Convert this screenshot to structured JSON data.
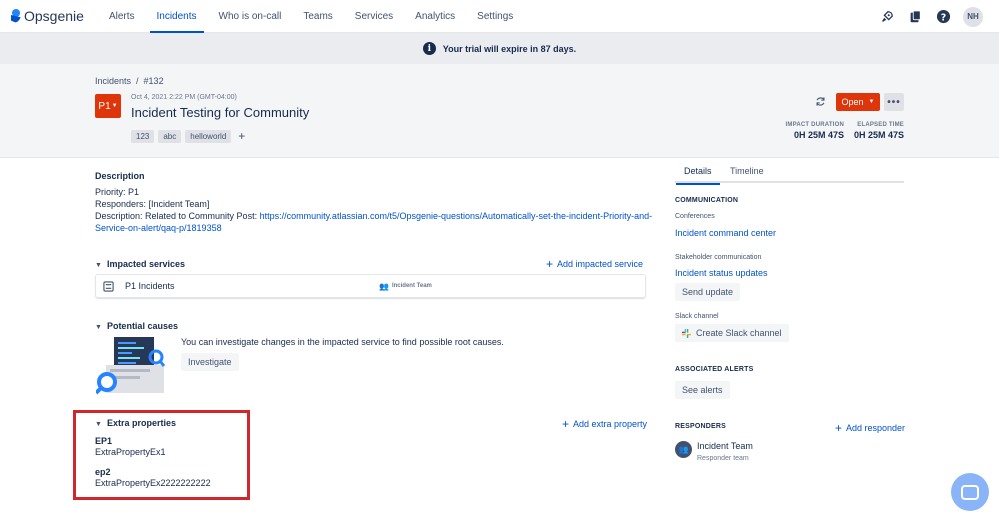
{
  "app": {
    "name": "Opsgenie"
  },
  "nav": {
    "items": [
      {
        "label": "Alerts",
        "active": false
      },
      {
        "label": "Incidents",
        "active": true
      },
      {
        "label": "Who is on-call",
        "active": false
      },
      {
        "label": "Teams",
        "active": false
      },
      {
        "label": "Services",
        "active": false
      },
      {
        "label": "Analytics",
        "active": false
      },
      {
        "label": "Settings",
        "active": false
      }
    ],
    "avatar_initials": "NH"
  },
  "banner": {
    "text": "Your trial will expire in 87 days."
  },
  "header": {
    "breadcrumb_root": "Incidents",
    "breadcrumb_sep": "/",
    "breadcrumb_id": "#132",
    "priority": "P1",
    "priority_color": "#de350b",
    "date": "Oct 4, 2021 2:22 PM (GMT-04:00)",
    "title": "Incident Testing for Community",
    "tags": [
      "123",
      "abc",
      "helloworld"
    ],
    "status_label": "Open",
    "status_color": "#de350b",
    "impact_duration_label": "IMPACT DURATION",
    "impact_duration": "0H 25M 47S",
    "elapsed_time_label": "ELAPSED TIME",
    "elapsed_time": "0H 25M 47S"
  },
  "description": {
    "heading": "Description",
    "priority_line": "Priority: P1",
    "responders_line": "Responders: [Incident Team]",
    "desc_prefix": "Description: Related to Community Post: ",
    "url_part1": "https://community.atlassian.com/t5/Opsgenie-questions/Automatically-set-the-incident-Priority-and-",
    "url_part2": "Service-on-alert/qaq-p/1819358"
  },
  "impacted_services": {
    "heading": "Impacted services",
    "add_label": "Add impacted service",
    "rows": [
      {
        "name": "P1 Incidents",
        "team": "Incident Team"
      }
    ]
  },
  "potential_causes": {
    "heading": "Potential causes",
    "text": "You can investigate changes in the impacted service to find possible root causes.",
    "button": "Investigate"
  },
  "extra_properties": {
    "heading": "Extra properties",
    "add_label": "Add extra property",
    "items": [
      {
        "key": "EP1",
        "value": "ExtraPropertyEx1"
      },
      {
        "key": "ep2",
        "value": "ExtraPropertyEx2222222222"
      }
    ]
  },
  "right_panel": {
    "tabs": [
      "Details",
      "Timeline"
    ],
    "communication_heading": "COMMUNICATION",
    "conferences_label": "Conferences",
    "conference_link": "Incident command center",
    "stakeholder_label": "Stakeholder communication",
    "status_updates_link": "Incident status updates",
    "send_update_button": "Send update",
    "slack_label": "Slack channel",
    "slack_button": "Create Slack channel",
    "associated_alerts_heading": "ASSOCIATED ALERTS",
    "see_alerts_button": "See alerts",
    "responders_heading": "RESPONDERS",
    "add_responder_label": "Add responder",
    "responder_name": "Incident Team",
    "responder_type": "Responder team"
  }
}
